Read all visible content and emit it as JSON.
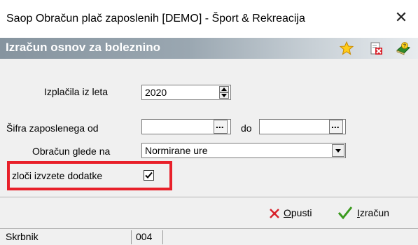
{
  "window": {
    "title": "Saop Obračun plač zaposlenih [DEMO] - Šport & Rekreacija",
    "close_glyph": "✕"
  },
  "header": {
    "title": "Izračun osnov za boleznino",
    "icons": [
      "star-icon",
      "document-delete-icon",
      "book-help-icon"
    ]
  },
  "form": {
    "year_label": "Izplačila iz leta",
    "year_value": "2020",
    "employee_code_label": "Šifra zaposlenega od",
    "employee_from_value": "",
    "employee_to_label": "do",
    "employee_to_value": "",
    "calc_basis_label": "Obračun glede na",
    "calc_basis_value": "Normirane ure",
    "separate_label": "zloči izvzete dodatke",
    "separate_checked": true,
    "ellipsis": "..."
  },
  "actions": {
    "cancel_prefix": "",
    "cancel_hotkey": "O",
    "cancel_rest": "pusti",
    "calc_hotkey": "I",
    "calc_rest": "zračun"
  },
  "status": {
    "label": "Skrbnik",
    "value": "004"
  },
  "colors": {
    "highlight_box": "#e8202a",
    "header_gradient_start": "#86949f",
    "cancel_x": "#d8202a",
    "check_green": "#3a9a1e"
  }
}
